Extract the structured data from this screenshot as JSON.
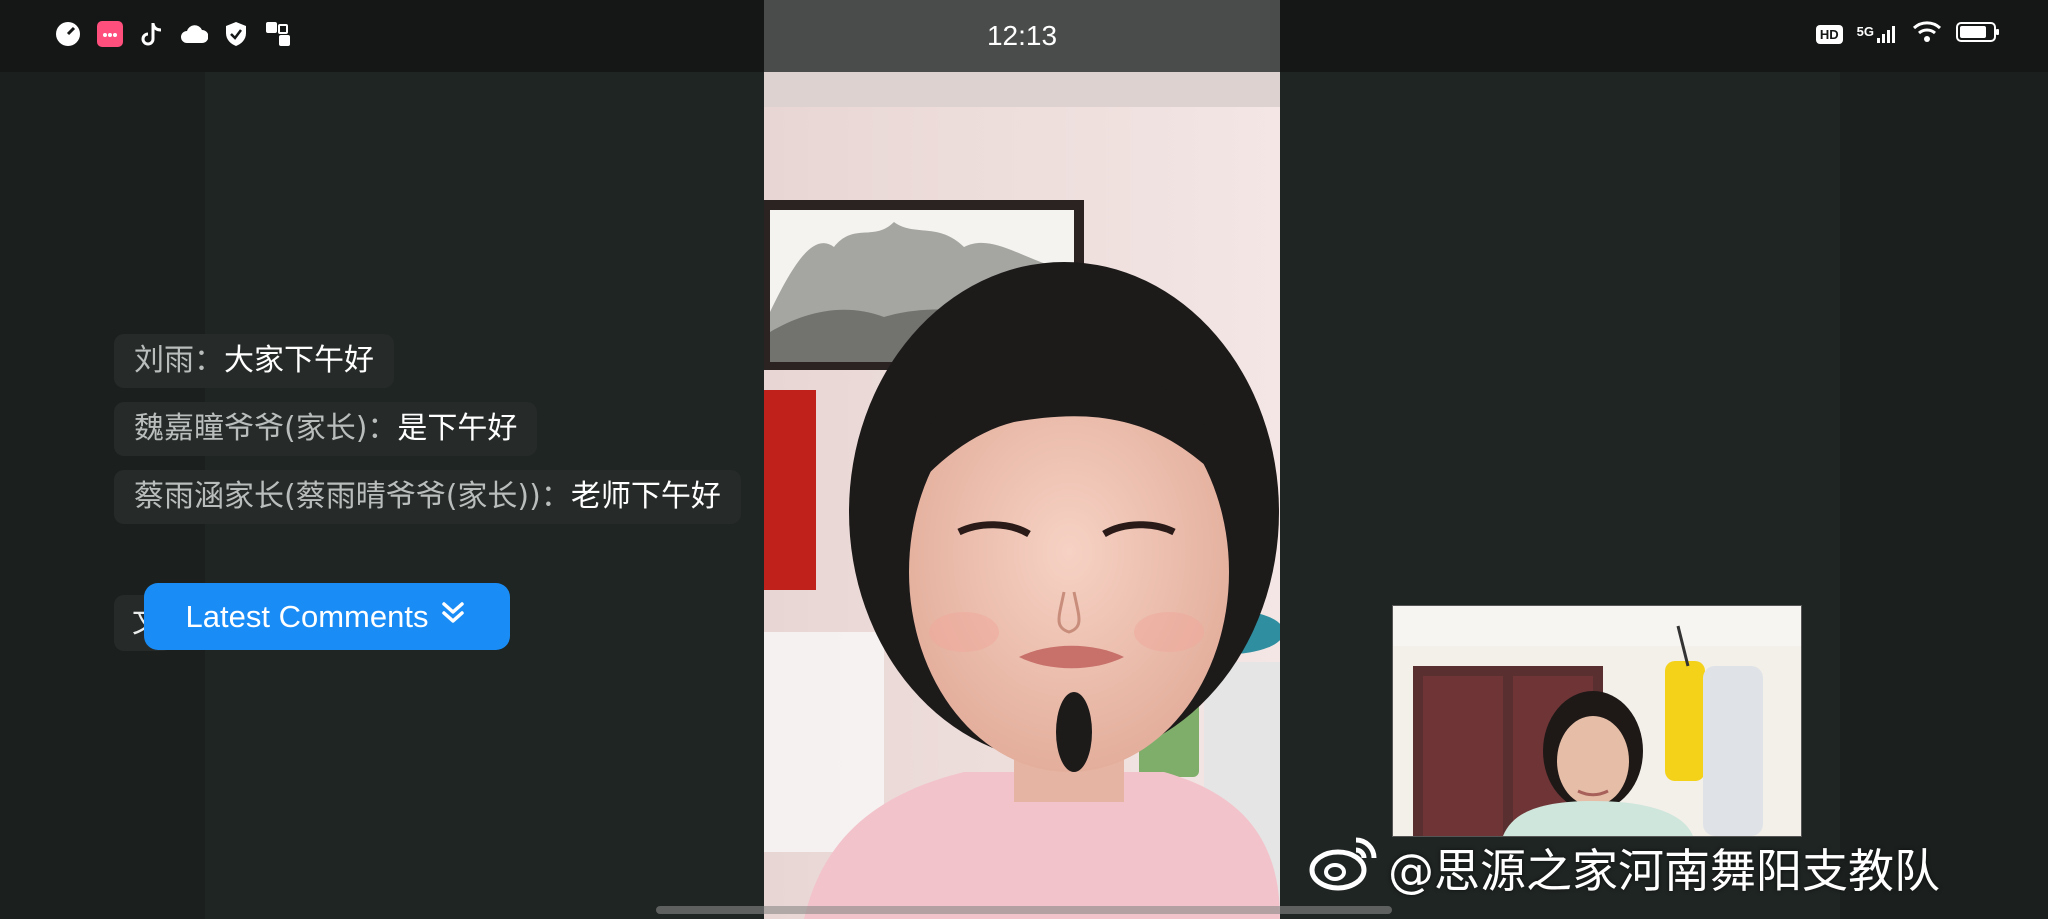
{
  "status_bar": {
    "time": "12:13",
    "left_icons": [
      "timer-app-icon",
      "pink-app-icon",
      "tiktok-icon",
      "cloud-icon",
      "shield-icon",
      "multi-window-icon"
    ],
    "right_icons": [
      "hd-icon",
      "5g-signal-icon",
      "wifi-icon",
      "battery-icon"
    ],
    "hd_label": "HD",
    "network_label": "5G"
  },
  "comments": [
    {
      "user": "刘雨",
      "sep": "：",
      "message": "大家下午好"
    },
    {
      "user": "魏嘉瞳爷爷(家长)",
      "sep": "：",
      "message": "是下午好"
    },
    {
      "user": "蔡雨涵家长(蔡雨晴爷爷(家长))",
      "sep": "：",
      "message": "老师下午好"
    }
  ],
  "partial_comment_initial": "文",
  "latest_comments_button": "Latest Comments",
  "watermark": {
    "text": "@思源之家河南舞阳支教队"
  },
  "colors": {
    "accent_blue": "#1a8cf5",
    "panel_dark": "#1f2523",
    "status_bar": "#141716"
  }
}
